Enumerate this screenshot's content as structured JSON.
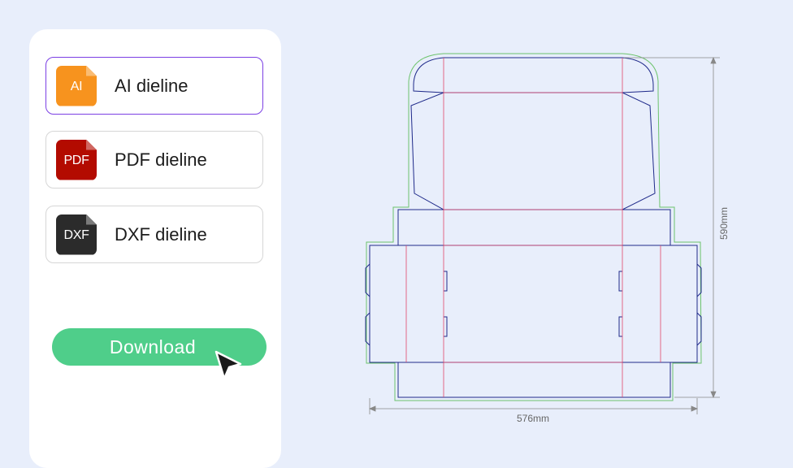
{
  "options": [
    {
      "icon_text": "AI",
      "icon_name": "ai-file-icon",
      "label": "AI dieline",
      "color": "#f7931e",
      "selected": true
    },
    {
      "icon_text": "PDF",
      "icon_name": "pdf-file-icon",
      "label": "PDF dieline",
      "color": "#b30b00",
      "selected": false
    },
    {
      "icon_text": "DXF",
      "icon_name": "dxf-file-icon",
      "label": "DXF dieline",
      "color": "#2b2b2b",
      "selected": false
    }
  ],
  "download": {
    "label": "Download",
    "color": "#4fce8a"
  },
  "dieline": {
    "width_label": "576mm",
    "height_label": "590mm",
    "cut_color": "#1f2a8a",
    "fold_color": "#e0466a",
    "bleed_color": "#6cc36c"
  }
}
